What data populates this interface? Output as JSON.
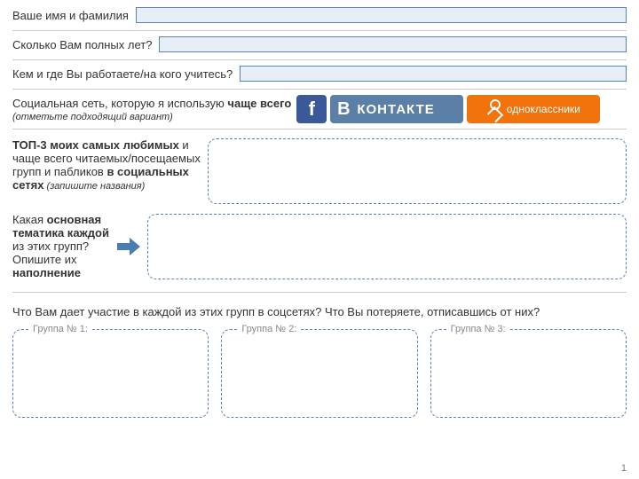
{
  "q1": {
    "label": "Ваше имя и фамилия"
  },
  "q2": {
    "label": "Сколько Вам полных лет?"
  },
  "q3": {
    "label": "Кем и где Вы работаете/на кого учитесь?"
  },
  "social": {
    "text_before_bold": "Социальная сеть, которую я использую ",
    "text_bold": "чаще всего",
    "hint": "(отметьте подходящий вариант)",
    "fb": "f",
    "vk_b": "В",
    "vk_text": "КОНТАКТЕ",
    "ok_text": "одноклассники"
  },
  "top3": {
    "line1_bold": "ТОП-3 моих самых любимых",
    "line1_after": " и чаще всего читаемых/посещаемых групп и пабликов ",
    "line1_bold2": "в социальных сетях",
    "hint": " (запишите названия)"
  },
  "theme": {
    "t1": "Какая ",
    "b1": "основная тематика каждой",
    "t2": " из этих групп? Опишите их ",
    "b2": "наполнение"
  },
  "question": "Что Вам дает участие в каждой из этих групп в соцсетях? Что Вы потеряете, отписавшись от них?",
  "groups": {
    "g1": "Группа № 1:",
    "g2": "Группа № 2:",
    "g3": "Группа № 3:"
  },
  "page": "1"
}
